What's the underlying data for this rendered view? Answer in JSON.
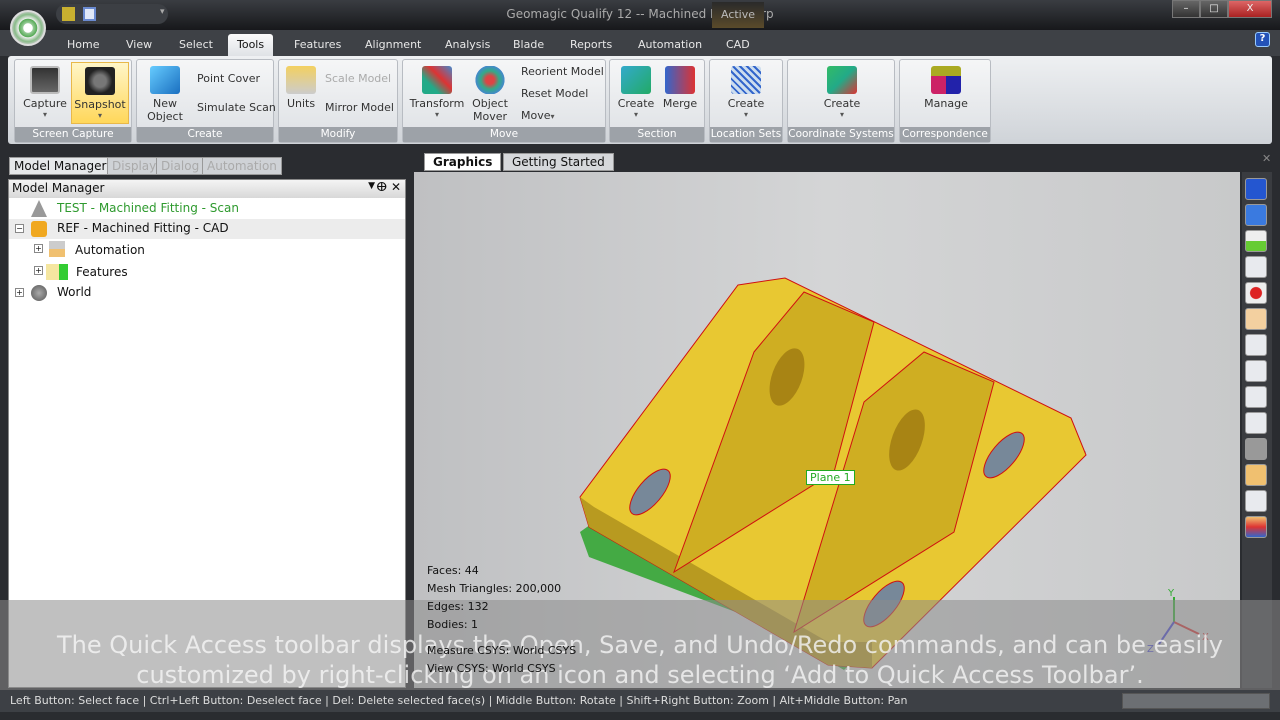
{
  "window": {
    "title": "Geomagic Qualify 12 -- Machined Fitting.wrp",
    "context_tab_label": "Active",
    "minimize": "–",
    "maximize": "□",
    "close": "X",
    "help": "?"
  },
  "menu_tabs": [
    "Home",
    "View",
    "Select",
    "Tools",
    "Features",
    "Alignment",
    "Analysis",
    "Blade",
    "Reports",
    "Automation",
    "CAD"
  ],
  "active_tab": "Tools",
  "ribbon": {
    "screen_capture": {
      "label": "Screen Capture",
      "capture": "Capture",
      "snapshot": "Snapshot"
    },
    "create": {
      "label": "Create",
      "new_object": "New Object",
      "point_cover": "Point Cover",
      "simulate_scan": "Simulate Scan"
    },
    "modify": {
      "label": "Modify",
      "units": "Units",
      "scale_model": "Scale Model",
      "mirror_model": "Mirror Model"
    },
    "move": {
      "label": "Move",
      "transform": "Transform",
      "object_mover": "Object Mover",
      "reorient_model": "Reorient Model",
      "reset_model": "Reset Model",
      "move": "Move"
    },
    "section": {
      "label": "Section",
      "create": "Create",
      "merge": "Merge"
    },
    "location_sets": {
      "label": "Location Sets",
      "create": "Create"
    },
    "coordinate_systems": {
      "label": "Coordinate Systems",
      "create": "Create"
    },
    "correspondence": {
      "label": "Correspondence",
      "manage": "Manage"
    }
  },
  "panel_tabs": [
    "Model Manager",
    "Display",
    "Dialog",
    "Automation"
  ],
  "model_manager": {
    "title": "Model Manager",
    "items": [
      {
        "label": "TEST - Machined Fitting - Scan",
        "color": "#2e9a2e"
      },
      {
        "label": "REF - Machined Fitting - CAD"
      },
      {
        "label": "Automation"
      },
      {
        "label": "Features"
      },
      {
        "label": "World"
      }
    ]
  },
  "graphics_tabs": [
    "Graphics",
    "Getting Started"
  ],
  "viewport": {
    "plane_label": "Plane 1",
    "stats": [
      "Faces: 44",
      "Mesh Triangles: 200,000",
      "Edges: 132",
      "Bodies: 1",
      "Measure CSYS: World CSYS",
      "View CSYS: World CSYS"
    ],
    "axes": {
      "x": "X",
      "y": "Y",
      "z": "Z"
    }
  },
  "caption": [
    "The Quick Access toolbar displays the Open, Save, and Undo/Redo commands, and can be easily",
    "customized by right-clicking on an icon and selecting ‘Add to Quick Access Toolbar’."
  ],
  "status_bar": "Left Button: Select face | Ctrl+Left Button: Deselect face | Del: Delete selected face(s) | Middle Button: Rotate | Shift+Right Button: Zoom | Alt+Middle Button: Pan",
  "colors": {
    "model": "#e8c832",
    "edge": "#d01010",
    "accent": "#ffd75a"
  }
}
